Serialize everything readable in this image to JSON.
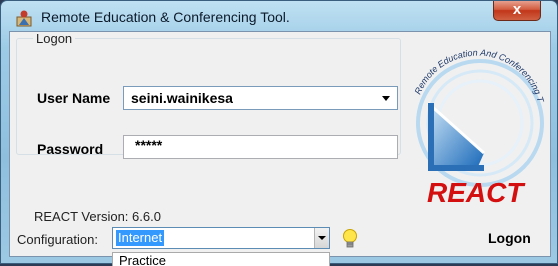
{
  "window": {
    "title": "Remote Education & Conferencing Tool.",
    "close_glyph": "x"
  },
  "logon_group": {
    "legend": "Logon",
    "user_name_label": "User Name",
    "user_name_value": "seini.wainikesa",
    "password_label": "Password",
    "password_value": "*****"
  },
  "logo": {
    "arc_text": "Remote Education And Conferencing Tool",
    "word": "REACT"
  },
  "footer": {
    "version_label": "REACT Version:",
    "version_value": "6.6.0",
    "config_label": "Configuration:",
    "config_value": "Internet",
    "dropdown_option": "Practice",
    "logon_button": "Logon"
  },
  "icons": [
    "app-icon",
    "close-icon",
    "chevron-down-icon",
    "lightbulb-icon"
  ],
  "colors": {
    "react_red": "#d40f0f",
    "selection_blue": "#3399ff",
    "logo_blue": "#1f7ed0"
  }
}
